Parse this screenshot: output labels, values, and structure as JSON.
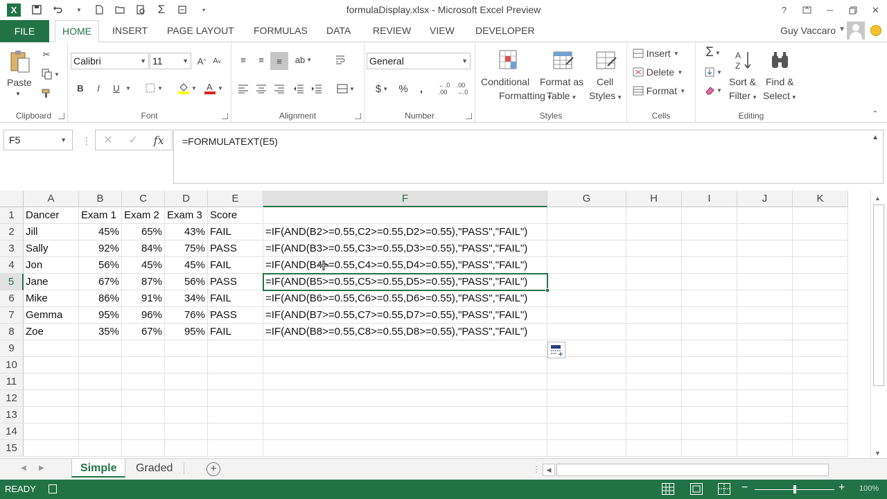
{
  "window": {
    "title": "formulaDisplay.xlsx - Microsoft Excel Preview",
    "app_logo": "X",
    "user": "Guy Vaccaro"
  },
  "ribbon_tabs": [
    "FILE",
    "HOME",
    "INSERT",
    "PAGE LAYOUT",
    "FORMULAS",
    "DATA",
    "REVIEW",
    "VIEW",
    "DEVELOPER"
  ],
  "active_tab": "HOME",
  "clipboard": {
    "paste": "Paste",
    "label": "Clipboard"
  },
  "font": {
    "name": "Calibri",
    "size": "11",
    "bold": "B",
    "italic": "I",
    "underline": "U",
    "label": "Font"
  },
  "alignment": {
    "label": "Alignment"
  },
  "number": {
    "format": "General",
    "currency": "$",
    "percent": "%",
    "comma": ",",
    "label": "Number"
  },
  "styles": {
    "conditional_1": "Conditional",
    "conditional_2": "Formatting",
    "table_1": "Format as",
    "table_2": "Table",
    "cell_1": "Cell",
    "cell_2": "Styles",
    "label": "Styles"
  },
  "cells_group": {
    "insert": "Insert",
    "delete": "Delete",
    "format": "Format",
    "label": "Cells"
  },
  "editing": {
    "sigma": "Σ",
    "sort_1": "Sort &",
    "sort_2": "Filter",
    "find_1": "Find &",
    "find_2": "Select",
    "label": "Editing"
  },
  "formula_bar": {
    "name_box": "F5",
    "cancel": "✕",
    "enter": "✓",
    "fx": "fx",
    "formula": "=FORMULATEXT(E5)"
  },
  "columns": [
    "A",
    "B",
    "C",
    "D",
    "E",
    "F",
    "G",
    "H",
    "I",
    "J",
    "K"
  ],
  "rows": [
    "1",
    "2",
    "3",
    "4",
    "5",
    "6",
    "7",
    "8",
    "9",
    "10",
    "11",
    "12",
    "13",
    "14",
    "15"
  ],
  "sheet": {
    "headers": [
      "Dancer",
      "Exam 1",
      "Exam 2",
      "Exam 3",
      "Score"
    ],
    "data": [
      [
        "Jill",
        "45%",
        "65%",
        "43%",
        "FAIL",
        "=IF(AND(B2>=0.55,C2>=0.55,D2>=0.55),\"PASS\",\"FAIL\")"
      ],
      [
        "Sally",
        "92%",
        "84%",
        "75%",
        "PASS",
        "=IF(AND(B3>=0.55,C3>=0.55,D3>=0.55),\"PASS\",\"FAIL\")"
      ],
      [
        "Jon",
        "56%",
        "45%",
        "45%",
        "FAIL",
        "=IF(AND(B4>=0.55,C4>=0.55,D4>=0.55),\"PASS\",\"FAIL\")"
      ],
      [
        "Jane",
        "67%",
        "87%",
        "56%",
        "PASS",
        "=IF(AND(B5>=0.55,C5>=0.55,D5>=0.55),\"PASS\",\"FAIL\")"
      ],
      [
        "Mike",
        "86%",
        "91%",
        "34%",
        "FAIL",
        "=IF(AND(B6>=0.55,C6>=0.55,D6>=0.55),\"PASS\",\"FAIL\")"
      ],
      [
        "Gemma",
        "95%",
        "96%",
        "76%",
        "PASS",
        "=IF(AND(B7>=0.55,C7>=0.55,D7>=0.55),\"PASS\",\"FAIL\")"
      ],
      [
        "Zoe",
        "35%",
        "67%",
        "95%",
        "FAIL",
        "=IF(AND(B8>=0.55,C8>=0.55,D8>=0.55),\"PASS\",\"FAIL\")"
      ]
    ],
    "selected_column": "F",
    "selected_row": "5"
  },
  "sheet_tabs": [
    "Simple",
    "Graded"
  ],
  "active_sheet": "Simple",
  "status": {
    "mode": "READY",
    "zoom": "100%"
  },
  "colors": {
    "accent": "#217346"
  },
  "icons": [
    "save-icon",
    "undo-icon",
    "redo-icon",
    "new-icon",
    "open-icon",
    "print-preview-icon",
    "autosum-icon",
    "customize-icon",
    "help-icon",
    "restore-icon",
    "minimize-icon",
    "maximize-icon",
    "close-icon"
  ]
}
